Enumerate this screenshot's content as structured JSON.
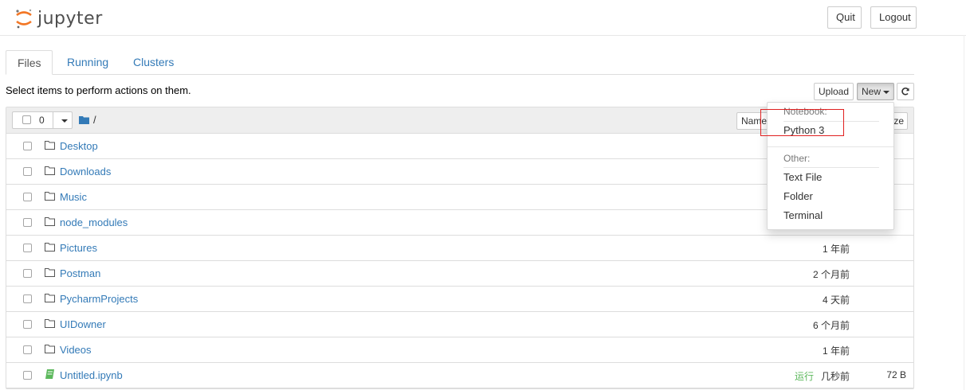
{
  "header": {
    "logo_text": "jupyter",
    "quit_label": "Quit",
    "logout_label": "Logout"
  },
  "tabs": [
    {
      "label": "Files",
      "active": true
    },
    {
      "label": "Running",
      "active": false
    },
    {
      "label": "Clusters",
      "active": false
    }
  ],
  "toolbar": {
    "hint": "Select items to perform actions on them.",
    "upload_label": "Upload",
    "new_label": "New",
    "refresh_icon": "refresh-icon"
  },
  "list_header": {
    "selected_count": "0",
    "breadcrumb_separator": "/",
    "name_sort_label": "Name",
    "size_sort_label": "ze"
  },
  "files": [
    {
      "name": "Desktop",
      "type": "folder",
      "modified": "",
      "size": "",
      "status": ""
    },
    {
      "name": "Downloads",
      "type": "folder",
      "modified": "",
      "size": "",
      "status": ""
    },
    {
      "name": "Music",
      "type": "folder",
      "modified": "",
      "size": "",
      "status": ""
    },
    {
      "name": "node_modules",
      "type": "folder",
      "modified": "",
      "size": "",
      "status": ""
    },
    {
      "name": "Pictures",
      "type": "folder",
      "modified": "1 年前",
      "size": "",
      "status": ""
    },
    {
      "name": "Postman",
      "type": "folder",
      "modified": "2 个月前",
      "size": "",
      "status": ""
    },
    {
      "name": "PycharmProjects",
      "type": "folder",
      "modified": "4 天前",
      "size": "",
      "status": ""
    },
    {
      "name": "UIDowner",
      "type": "folder",
      "modified": "6 个月前",
      "size": "",
      "status": ""
    },
    {
      "name": "Videos",
      "type": "folder",
      "modified": "1 年前",
      "size": "",
      "status": ""
    },
    {
      "name": "Untitled.ipynb",
      "type": "notebook",
      "modified": "几秒前",
      "size": "72 B",
      "status": "运行"
    }
  ],
  "new_menu": {
    "notebook_header": "Notebook:",
    "python_label": "Python 3",
    "other_header": "Other:",
    "text_file_label": "Text File",
    "folder_label": "Folder",
    "terminal_label": "Terminal"
  },
  "colors": {
    "link": "#337ab7",
    "running": "#5cb85c",
    "notebook_icon": "#5cb85c",
    "highlight": "#e02020",
    "logo_orange": "#f37726"
  }
}
